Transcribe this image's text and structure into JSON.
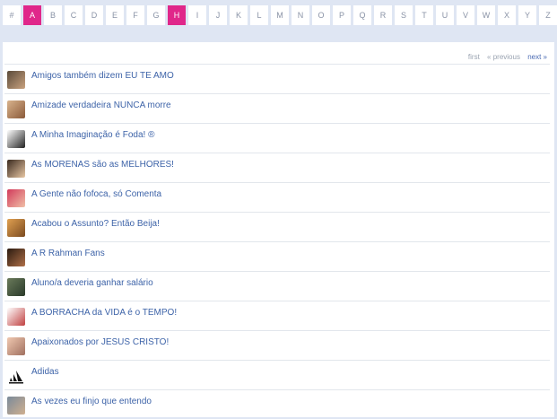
{
  "alphabet": [
    "#",
    "A",
    "B",
    "C",
    "D",
    "E",
    "F",
    "G",
    "H",
    "I",
    "J",
    "K",
    "L",
    "M",
    "N",
    "O",
    "P",
    "Q",
    "R",
    "S",
    "T",
    "U",
    "V",
    "W",
    "X",
    "Y",
    "Z"
  ],
  "active_letters": [
    "A",
    "H"
  ],
  "accent_color": "#e0278a",
  "link_color": "#3d63a8",
  "pager": {
    "first": "first",
    "previous": "« previous",
    "next": "next »"
  },
  "communities": [
    {
      "title": "Amigos também dizem EU TE AMO",
      "icon": "community-thumbnail-icon"
    },
    {
      "title": "Amizade verdadeira NUNCA morre",
      "icon": "community-thumbnail-icon"
    },
    {
      "title": "A Minha Imaginação é Foda! ®",
      "icon": "community-thumbnail-icon"
    },
    {
      "title": "As MORENAS são as MELHORES!",
      "icon": "community-thumbnail-icon"
    },
    {
      "title": "A Gente não fofoca, só Comenta",
      "icon": "community-thumbnail-icon"
    },
    {
      "title": "Acabou o Assunto? Então Beija!",
      "icon": "community-thumbnail-icon"
    },
    {
      "title": "A R Rahman Fans",
      "icon": "community-thumbnail-icon"
    },
    {
      "title": "Aluno/a deveria ganhar salário",
      "icon": "community-thumbnail-icon"
    },
    {
      "title": "A BORRACHA da VIDA é o TEMPO!",
      "icon": "community-thumbnail-icon"
    },
    {
      "title": "Apaixonados por JESUS CRISTO!",
      "icon": "community-thumbnail-icon"
    },
    {
      "title": "Adidas",
      "icon": "adidas-logo-icon"
    },
    {
      "title": "As vezes eu finjo que entendo",
      "icon": "community-thumbnail-icon"
    }
  ]
}
